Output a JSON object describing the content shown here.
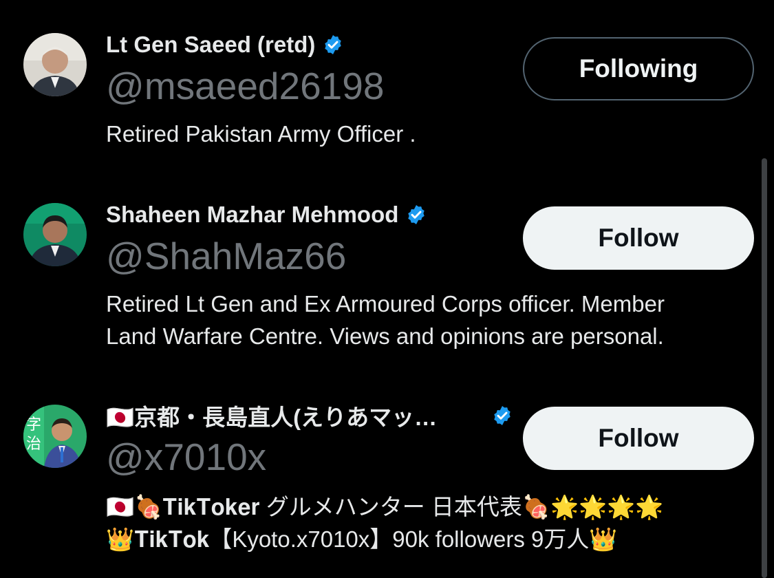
{
  "accent": "#1d9bf0",
  "users": [
    {
      "name": "Lt Gen Saeed (retd)",
      "handle": "@msaeed26198",
      "bio": [
        "Retired Pakistan Army Officer ."
      ],
      "button_label": "Following",
      "verified": true
    },
    {
      "name": "Shaheen Mazhar Mehmood",
      "handle": "@ShahMaz66",
      "bio": [
        "Retired Lt Gen and Ex Armoured Corps officer. Member",
        "Land Warfare Centre. Views and opinions are personal."
      ],
      "button_label": "Follow",
      "verified": true
    },
    {
      "name": "🇯🇵京都・長島直人(えりあマッ…",
      "handle": "@x7010x",
      "bio": [
        "🇯🇵🍖𝐓𝐢𝐤𝐓𝐨𝐤𝐞𝐫 グルメハンター 日本代表🍖🌟🌟🌟🌟",
        "👑𝐓𝐢𝐤𝐓𝐨𝐤【Kyoto.x7010x】90k followers 9万人👑"
      ],
      "button_label": "Follow",
      "verified": true
    }
  ]
}
